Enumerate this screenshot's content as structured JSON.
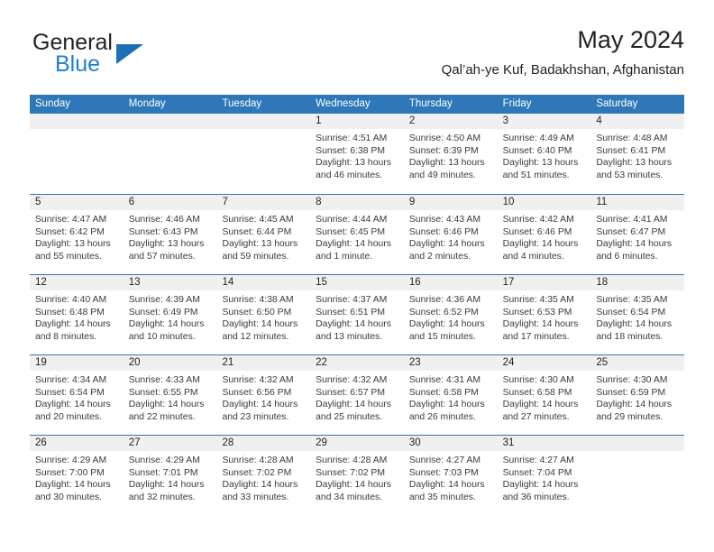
{
  "brand": {
    "word1": "General",
    "word2": "Blue",
    "triangle_color": "#1c6fb5",
    "blue_color": "#1c7fd4"
  },
  "header": {
    "title": "May 2024",
    "location": "Qal’ah-ye Kuf, Badakhshan, Afghanistan"
  },
  "theme": {
    "header_blue": "#2e77b8",
    "daynum_band": "#f0f0f0",
    "text": "#231f20"
  },
  "weekdays": [
    "Sunday",
    "Monday",
    "Tuesday",
    "Wednesday",
    "Thursday",
    "Friday",
    "Saturday"
  ],
  "weeks": [
    [
      {
        "day": "",
        "sunrise": "",
        "sunset": "",
        "daylight1": "",
        "daylight2": ""
      },
      {
        "day": "",
        "sunrise": "",
        "sunset": "",
        "daylight1": "",
        "daylight2": ""
      },
      {
        "day": "",
        "sunrise": "",
        "sunset": "",
        "daylight1": "",
        "daylight2": ""
      },
      {
        "day": "1",
        "sunrise": "Sunrise: 4:51 AM",
        "sunset": "Sunset: 6:38 PM",
        "daylight1": "Daylight: 13 hours",
        "daylight2": "and 46 minutes."
      },
      {
        "day": "2",
        "sunrise": "Sunrise: 4:50 AM",
        "sunset": "Sunset: 6:39 PM",
        "daylight1": "Daylight: 13 hours",
        "daylight2": "and 49 minutes."
      },
      {
        "day": "3",
        "sunrise": "Sunrise: 4:49 AM",
        "sunset": "Sunset: 6:40 PM",
        "daylight1": "Daylight: 13 hours",
        "daylight2": "and 51 minutes."
      },
      {
        "day": "4",
        "sunrise": "Sunrise: 4:48 AM",
        "sunset": "Sunset: 6:41 PM",
        "daylight1": "Daylight: 13 hours",
        "daylight2": "and 53 minutes."
      }
    ],
    [
      {
        "day": "5",
        "sunrise": "Sunrise: 4:47 AM",
        "sunset": "Sunset: 6:42 PM",
        "daylight1": "Daylight: 13 hours",
        "daylight2": "and 55 minutes."
      },
      {
        "day": "6",
        "sunrise": "Sunrise: 4:46 AM",
        "sunset": "Sunset: 6:43 PM",
        "daylight1": "Daylight: 13 hours",
        "daylight2": "and 57 minutes."
      },
      {
        "day": "7",
        "sunrise": "Sunrise: 4:45 AM",
        "sunset": "Sunset: 6:44 PM",
        "daylight1": "Daylight: 13 hours",
        "daylight2": "and 59 minutes."
      },
      {
        "day": "8",
        "sunrise": "Sunrise: 4:44 AM",
        "sunset": "Sunset: 6:45 PM",
        "daylight1": "Daylight: 14 hours",
        "daylight2": "and 1 minute."
      },
      {
        "day": "9",
        "sunrise": "Sunrise: 4:43 AM",
        "sunset": "Sunset: 6:46 PM",
        "daylight1": "Daylight: 14 hours",
        "daylight2": "and 2 minutes."
      },
      {
        "day": "10",
        "sunrise": "Sunrise: 4:42 AM",
        "sunset": "Sunset: 6:46 PM",
        "daylight1": "Daylight: 14 hours",
        "daylight2": "and 4 minutes."
      },
      {
        "day": "11",
        "sunrise": "Sunrise: 4:41 AM",
        "sunset": "Sunset: 6:47 PM",
        "daylight1": "Daylight: 14 hours",
        "daylight2": "and 6 minutes."
      }
    ],
    [
      {
        "day": "12",
        "sunrise": "Sunrise: 4:40 AM",
        "sunset": "Sunset: 6:48 PM",
        "daylight1": "Daylight: 14 hours",
        "daylight2": "and 8 minutes."
      },
      {
        "day": "13",
        "sunrise": "Sunrise: 4:39 AM",
        "sunset": "Sunset: 6:49 PM",
        "daylight1": "Daylight: 14 hours",
        "daylight2": "and 10 minutes."
      },
      {
        "day": "14",
        "sunrise": "Sunrise: 4:38 AM",
        "sunset": "Sunset: 6:50 PM",
        "daylight1": "Daylight: 14 hours",
        "daylight2": "and 12 minutes."
      },
      {
        "day": "15",
        "sunrise": "Sunrise: 4:37 AM",
        "sunset": "Sunset: 6:51 PM",
        "daylight1": "Daylight: 14 hours",
        "daylight2": "and 13 minutes."
      },
      {
        "day": "16",
        "sunrise": "Sunrise: 4:36 AM",
        "sunset": "Sunset: 6:52 PM",
        "daylight1": "Daylight: 14 hours",
        "daylight2": "and 15 minutes."
      },
      {
        "day": "17",
        "sunrise": "Sunrise: 4:35 AM",
        "sunset": "Sunset: 6:53 PM",
        "daylight1": "Daylight: 14 hours",
        "daylight2": "and 17 minutes."
      },
      {
        "day": "18",
        "sunrise": "Sunrise: 4:35 AM",
        "sunset": "Sunset: 6:54 PM",
        "daylight1": "Daylight: 14 hours",
        "daylight2": "and 18 minutes."
      }
    ],
    [
      {
        "day": "19",
        "sunrise": "Sunrise: 4:34 AM",
        "sunset": "Sunset: 6:54 PM",
        "daylight1": "Daylight: 14 hours",
        "daylight2": "and 20 minutes."
      },
      {
        "day": "20",
        "sunrise": "Sunrise: 4:33 AM",
        "sunset": "Sunset: 6:55 PM",
        "daylight1": "Daylight: 14 hours",
        "daylight2": "and 22 minutes."
      },
      {
        "day": "21",
        "sunrise": "Sunrise: 4:32 AM",
        "sunset": "Sunset: 6:56 PM",
        "daylight1": "Daylight: 14 hours",
        "daylight2": "and 23 minutes."
      },
      {
        "day": "22",
        "sunrise": "Sunrise: 4:32 AM",
        "sunset": "Sunset: 6:57 PM",
        "daylight1": "Daylight: 14 hours",
        "daylight2": "and 25 minutes."
      },
      {
        "day": "23",
        "sunrise": "Sunrise: 4:31 AM",
        "sunset": "Sunset: 6:58 PM",
        "daylight1": "Daylight: 14 hours",
        "daylight2": "and 26 minutes."
      },
      {
        "day": "24",
        "sunrise": "Sunrise: 4:30 AM",
        "sunset": "Sunset: 6:58 PM",
        "daylight1": "Daylight: 14 hours",
        "daylight2": "and 27 minutes."
      },
      {
        "day": "25",
        "sunrise": "Sunrise: 4:30 AM",
        "sunset": "Sunset: 6:59 PM",
        "daylight1": "Daylight: 14 hours",
        "daylight2": "and 29 minutes."
      }
    ],
    [
      {
        "day": "26",
        "sunrise": "Sunrise: 4:29 AM",
        "sunset": "Sunset: 7:00 PM",
        "daylight1": "Daylight: 14 hours",
        "daylight2": "and 30 minutes."
      },
      {
        "day": "27",
        "sunrise": "Sunrise: 4:29 AM",
        "sunset": "Sunset: 7:01 PM",
        "daylight1": "Daylight: 14 hours",
        "daylight2": "and 32 minutes."
      },
      {
        "day": "28",
        "sunrise": "Sunrise: 4:28 AM",
        "sunset": "Sunset: 7:02 PM",
        "daylight1": "Daylight: 14 hours",
        "daylight2": "and 33 minutes."
      },
      {
        "day": "29",
        "sunrise": "Sunrise: 4:28 AM",
        "sunset": "Sunset: 7:02 PM",
        "daylight1": "Daylight: 14 hours",
        "daylight2": "and 34 minutes."
      },
      {
        "day": "30",
        "sunrise": "Sunrise: 4:27 AM",
        "sunset": "Sunset: 7:03 PM",
        "daylight1": "Daylight: 14 hours",
        "daylight2": "and 35 minutes."
      },
      {
        "day": "31",
        "sunrise": "Sunrise: 4:27 AM",
        "sunset": "Sunset: 7:04 PM",
        "daylight1": "Daylight: 14 hours",
        "daylight2": "and 36 minutes."
      },
      {
        "day": "",
        "sunrise": "",
        "sunset": "",
        "daylight1": "",
        "daylight2": ""
      }
    ]
  ]
}
